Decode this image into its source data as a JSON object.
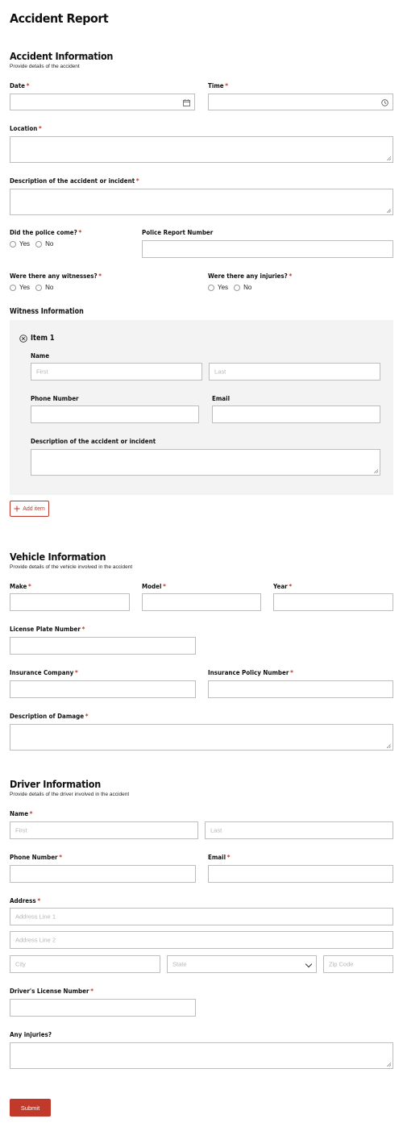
{
  "title": "Accident Report",
  "accident": {
    "heading": "Accident Information",
    "subheading": "Provide details of the accident",
    "date_label": "Date",
    "time_label": "Time",
    "location_label": "Location",
    "description_label": "Description of the accident or incident",
    "police_label": "Did the police come?",
    "police_report_label": "Police Report Number",
    "witnesses_label": "Were there any witnesses?",
    "injuries_label": "Were there any injuries?",
    "yes": "Yes",
    "no": "No",
    "required_mark": "*"
  },
  "witness": {
    "heading": "Witness Information",
    "item_title": "Item 1",
    "name_label": "Name",
    "first_placeholder": "First",
    "last_placeholder": "Last",
    "phone_label": "Phone Number",
    "email_label": "Email",
    "description_label": "Description of the accident or incident",
    "add_item_label": "Add item"
  },
  "vehicle": {
    "heading": "Vehicle Information",
    "subheading": "Provide details of the vehicle involved in the accident",
    "make_label": "Make",
    "model_label": "Model",
    "year_label": "Year",
    "plate_label": "License Plate Number",
    "insurance_company_label": "Insurance Company",
    "policy_label": "Insurance Policy Number",
    "damage_label": "Description of Damage"
  },
  "driver": {
    "heading": "Driver Information",
    "subheading": "Provide details of the driver involved in the accident",
    "name_label": "Name",
    "first_placeholder": "First",
    "last_placeholder": "Last",
    "phone_label": "Phone Number",
    "email_label": "Email",
    "address_label": "Address",
    "address1_placeholder": "Address Line 1",
    "address2_placeholder": "Address Line 2",
    "city_placeholder": "City",
    "state_placeholder": "State",
    "zip_placeholder": "Zip Code",
    "license_label": "Driver's License Number",
    "injuries_label": "Any injuries?"
  },
  "submit_label": "Submit",
  "colors": {
    "accent": "#c0392b",
    "item_bg": "#f3f3f3",
    "border": "#bdbdbd"
  }
}
